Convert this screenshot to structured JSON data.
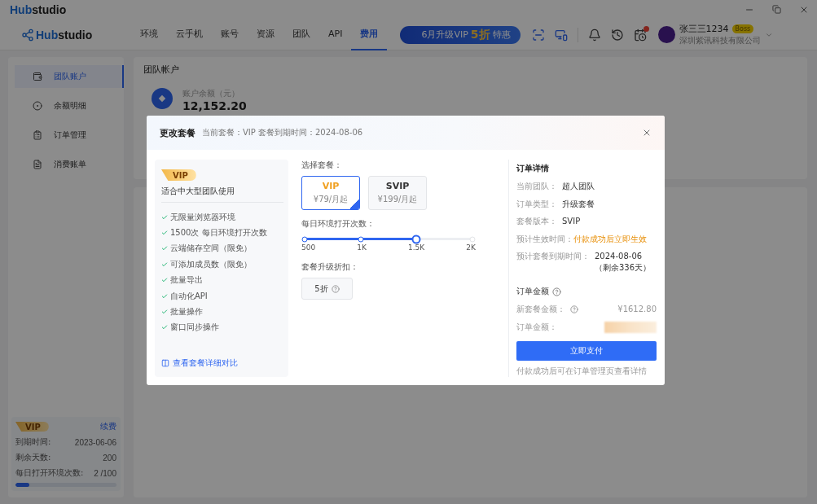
{
  "titlebar": {
    "logo": {
      "accent": "Hub",
      "rest": "studio"
    }
  },
  "navbar": {
    "logo": {
      "accent": "Hub",
      "rest": "studio"
    },
    "tabs": [
      {
        "label": "环境",
        "selected": false
      },
      {
        "label": "云手机",
        "selected": false
      },
      {
        "label": "账号",
        "selected": false
      },
      {
        "label": "资源",
        "selected": false
      },
      {
        "label": "团队",
        "selected": false
      },
      {
        "label": "API",
        "selected": false
      },
      {
        "label": "费用",
        "selected": true
      }
    ],
    "promo": {
      "lead": "6月升级VIP",
      "highlight": "5折",
      "tail": "特惠"
    },
    "notification_badge": true,
    "user": {
      "name": "张三三1234",
      "role": "Boss",
      "company": "深圳紫讯科技有限公司"
    }
  },
  "sidebar": {
    "items": [
      {
        "label": "团队账户",
        "selected": true
      },
      {
        "label": "余额明细",
        "selected": false
      },
      {
        "label": "订单管理",
        "selected": false
      },
      {
        "label": "消费账单",
        "selected": false
      }
    ],
    "plan_card": {
      "badge": "VIP",
      "renew": "续费",
      "rows": [
        {
          "label": "到期时间:",
          "value": "2023-06-06"
        },
        {
          "label": "剩余天数:",
          "value": "200"
        },
        {
          "label": "每日打开环境次数:",
          "value": "2 /100"
        }
      ],
      "level": 0.14
    }
  },
  "content": {
    "title": "团队帐户",
    "balance_label": "账户余额（元）",
    "balance": "12,152.20"
  },
  "dialog": {
    "title": "更改套餐",
    "subtitle": "当前套餐：VIP 套餐到期时间：2024-08-06",
    "feature_card": {
      "badge": "VIP",
      "summary": "适合中大型团队使用",
      "features": [
        "无限量浏览器环境",
        "1500次 每日环境打开次数",
        "云端储存空间（限免）",
        "可添加成员数（限免）",
        "批量导出",
        "自动化API",
        "批量操作",
        "窗口同步操作"
      ],
      "link": "查看套餐详细对比"
    },
    "plan_label": "选择套餐：",
    "plans": [
      {
        "name": "VIP",
        "price": "¥79/月起",
        "selected": true
      },
      {
        "name": "SVIP",
        "price": "¥199/月起",
        "selected": false
      }
    ],
    "slider_label": "每日环境打开次数：",
    "slider": {
      "ticks": [
        "500",
        "1K",
        "1.5K",
        "2K"
      ],
      "level": 0.667
    },
    "discount_label": "套餐升级折扣：",
    "discount": "5折",
    "order": {
      "title": "订单详情",
      "rows": [
        {
          "label": "当前团队：",
          "value": "超人团队",
          "kind": "plain"
        },
        {
          "label": "订单类型：",
          "value": "升级套餐",
          "kind": "plain"
        },
        {
          "label": "套餐版本：",
          "value": "SVIP",
          "kind": "plain"
        },
        {
          "label": "预计生效时间：",
          "value": "付款成功后立即生效",
          "kind": "highlight"
        },
        {
          "label": "预计套餐到期时间：",
          "value": "2024-08-06（剩余336天）",
          "kind": "plain"
        }
      ],
      "amount_title": "订单金额",
      "new_amount_label": "新套餐金额：",
      "new_amount": "¥1612.80",
      "order_amount_label": "订单金额：",
      "pay": "立即支付",
      "note": "付款成功后可在订单管理页查看详情"
    }
  }
}
